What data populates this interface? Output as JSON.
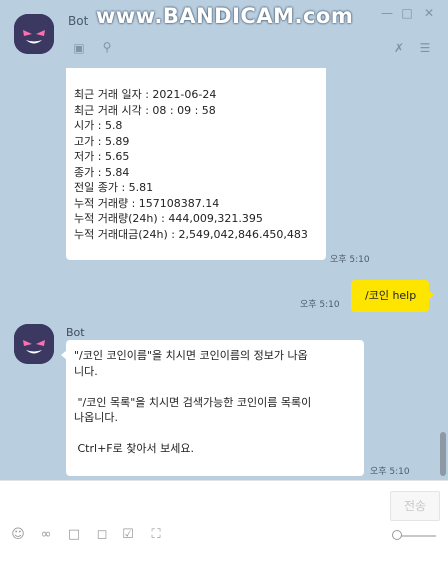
{
  "window": {
    "bot_name": "Bot",
    "watermark": "www.BANDICAM.com"
  },
  "messages": {
    "price_info": {
      "lines": [
        "최근 거래 일자 : 2021-06-24",
        "최근 거래 시각 : 08 : 09 : 58",
        "시가 : 5.8",
        "고가 : 5.89",
        "저가 : 5.65",
        "종가 : 5.84",
        "전일 종가 : 5.81",
        "누적 거래량 : 157108387.14",
        "누적 거래량(24h) : 444,009,321.395",
        "누적 거래대금(24h) : 2,549,042,846.450,483"
      ],
      "time": "오후 5:10"
    },
    "user_message": {
      "text": "/코인 help",
      "time": "오후 5:10"
    },
    "help_message": {
      "sender": "Bot",
      "lines": [
        "\"/코인 코인이름\"을 치시면 코인이름의 정보가 나옵",
        "니다.",
        "",
        " \"/코인 목록\"을 치시면 검색가능한 코인이름 목록이",
        "나옵니다.",
        "",
        " Ctrl+F로 찾아서 보세요."
      ],
      "time": "오후 5:10"
    }
  },
  "input": {
    "send_label": "전송"
  },
  "icons": {
    "header": [
      "drawer-icon",
      "search-icon"
    ],
    "header_right": [
      "mute-icon",
      "menu-icon"
    ],
    "window_controls": [
      "minimize-icon",
      "maximize-icon",
      "close-icon"
    ],
    "toolbar": [
      "emoji-icon",
      "attach-icon",
      "calendar-icon",
      "capture-icon"
    ]
  },
  "colors": {
    "chat_background": "#b9cedf",
    "my_bubble": "#fee500",
    "avatar_background": "#3b3962"
  }
}
